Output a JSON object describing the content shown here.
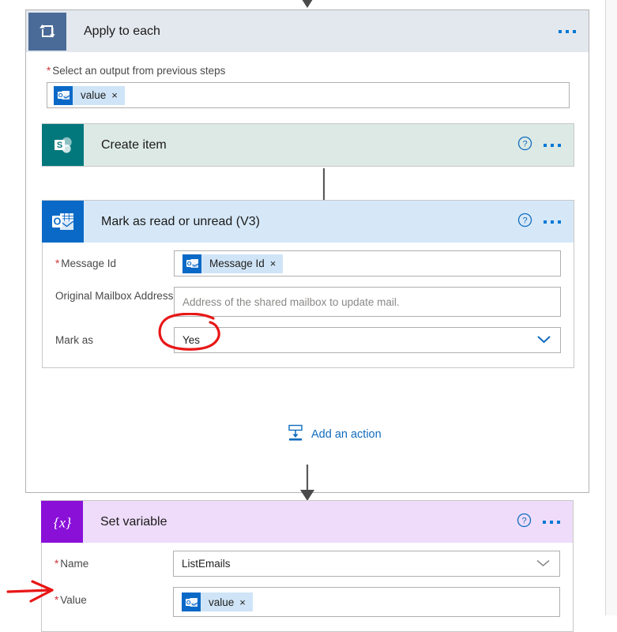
{
  "flow": {
    "scope": {
      "title": "Apply to each",
      "icon": "loop-icon",
      "menu_icon": "ellipsis-icon",
      "input_label": "Select an output from previous steps",
      "required_marker": "*",
      "token": {
        "text": "value",
        "icon": "outlook-icon",
        "remove_icon": "×"
      }
    },
    "actions": [
      {
        "id": "create-item",
        "title": "Create item",
        "icon": "sharepoint-icon",
        "help_icon": "help-circle-icon",
        "menu_icon": "ellipsis-icon",
        "collapsed": true
      },
      {
        "id": "mark-as-read-or-unread-v3",
        "title": "Mark as read or unread (V3)",
        "icon": "outlook-icon",
        "help_icon": "help-circle-icon",
        "menu_icon": "ellipsis-icon",
        "collapsed": false,
        "fields": [
          {
            "id": "message-id",
            "label": "Message Id",
            "required": true,
            "type": "token",
            "token": {
              "text": "Message Id",
              "icon": "outlook-icon",
              "remove_icon": "×"
            }
          },
          {
            "id": "original-mailbox-address",
            "label": "Original Mailbox Address",
            "required": false,
            "type": "text",
            "value": "",
            "placeholder": "Address of the shared mailbox to update mail."
          },
          {
            "id": "mark-as",
            "label": "Mark as",
            "required": false,
            "type": "dropdown",
            "value": "Yes",
            "chevron_icon": "chevron-down-icon",
            "chevron_color": "#0f6cbd"
          }
        ]
      }
    ],
    "add_action": {
      "label": "Add an action",
      "icon": "add-action-icon"
    },
    "set_variable": {
      "id": "set-variable",
      "title": "Set variable",
      "icon": "variable-braces-icon",
      "help_icon": "help-circle-icon",
      "menu_icon": "ellipsis-icon",
      "fields": [
        {
          "id": "name",
          "label": "Name",
          "required": true,
          "type": "dropdown",
          "value": "ListEmails",
          "chevron_icon": "chevron-down-icon",
          "chevron_color": "#8a8886"
        },
        {
          "id": "value",
          "label": "Value",
          "required": true,
          "type": "token",
          "token": {
            "text": "value",
            "icon": "outlook-icon",
            "remove_icon": "×"
          }
        }
      ]
    }
  },
  "annotations": {
    "circle": {
      "target": "Yes",
      "color": "#e81717",
      "shape": "hand-drawn-ellipse"
    },
    "arrow": {
      "target": "Value",
      "color": "#e81717",
      "shape": "hand-drawn-arrow-right"
    }
  },
  "colors": {
    "scope_header": "#e3e8ef",
    "sharepoint": "#03787c",
    "outlook": "#0a69c7",
    "variable": "#8a10d8",
    "link": "#0f6cbd",
    "required": "#d13438"
  }
}
